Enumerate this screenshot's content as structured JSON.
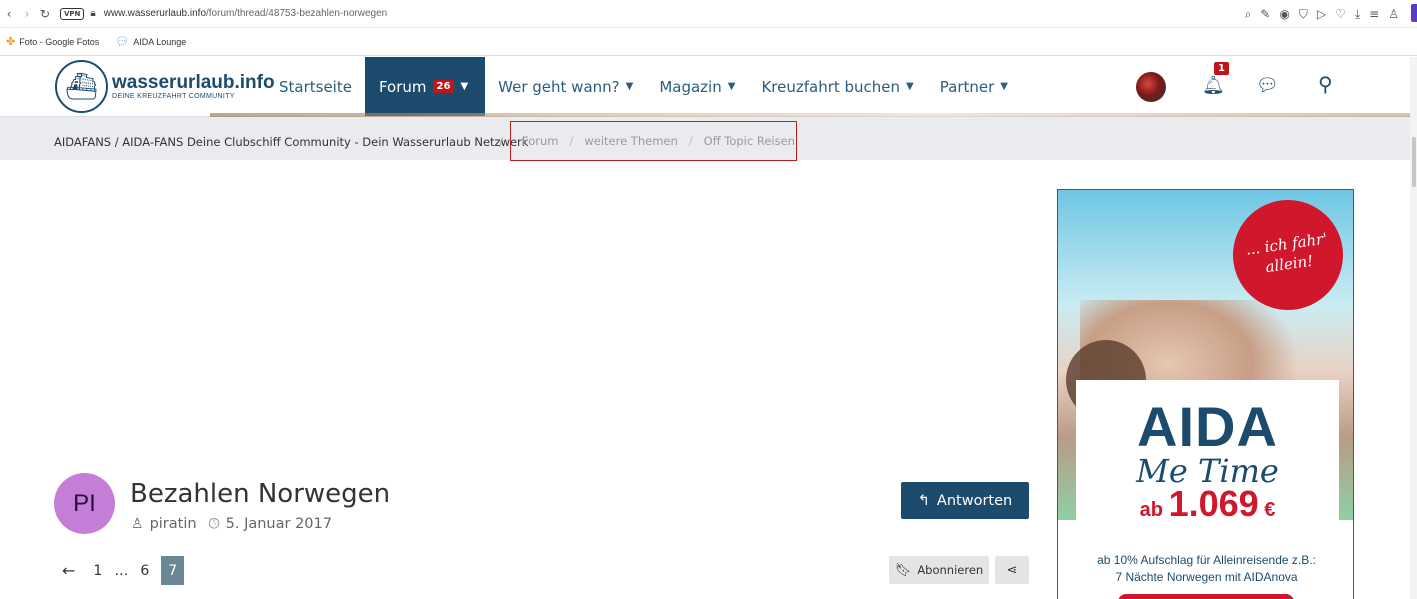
{
  "browser": {
    "url_host": "www.wasserurlaub.info",
    "url_path": "/forum/thread/48753-bezahlen-norwegen",
    "vpn_label": "VPN",
    "icons": [
      "back-icon",
      "forward-icon",
      "reload-icon",
      "vpn-icon",
      "lock-icon",
      "zoom-icon",
      "edit-icon",
      "camera-icon",
      "shield-icon",
      "play-icon",
      "heart-icon",
      "download-icon",
      "menu-icon",
      "profile-icon"
    ]
  },
  "bookmarks": [
    {
      "label": "Foto - Google Fotos",
      "icon": "pinwheel-icon"
    },
    {
      "label": "AIDA Lounge",
      "icon": "chat-bubble-icon"
    }
  ],
  "site": {
    "logo_title": "wasserurlaub.info",
    "logo_subtitle": "DEINE KREUZFAHRT COMMUNITY",
    "nav": [
      {
        "label": "Startseite"
      },
      {
        "label": "Forum",
        "badge": "26",
        "active": true
      },
      {
        "label": "Wer geht wann?"
      },
      {
        "label": "Magazin"
      },
      {
        "label": "Kreuzfahrt buchen"
      },
      {
        "label": "Partner"
      }
    ],
    "notification_count": "1",
    "colors": {
      "primary": "#1d4b6e",
      "badge": "#c3141b",
      "highlight_box": "#b62121"
    }
  },
  "breadcrumb": {
    "root": "AIDAFANS / AIDA-FANS Deine Clubschiff Community - Dein Wasserurlaub Netzwerk",
    "items": [
      "Forum",
      "weitere Themen",
      "Off Topic Reisen"
    ]
  },
  "ad": {
    "badge_line1": "... ich fahr'",
    "badge_line2": "allein!",
    "brand": "AIDA",
    "tagline": "Me Time",
    "price_prefix": "ab",
    "price": "1.069",
    "currency": "€",
    "footer_line1": "ab 10% Aufschlag für Alleinreisende z.B.:",
    "footer_line2": "7 Nächte Norwegen mit AIDAnova"
  },
  "thread": {
    "avatar_initials": "PI",
    "title": "Bezahlen Norwegen",
    "author": "piratin",
    "date": "5. Januar 2017",
    "reply_label": "Antworten",
    "subscribe_label": "Abonnieren"
  },
  "pagination": {
    "pages": [
      "1",
      "…",
      "6"
    ],
    "current": "7"
  }
}
